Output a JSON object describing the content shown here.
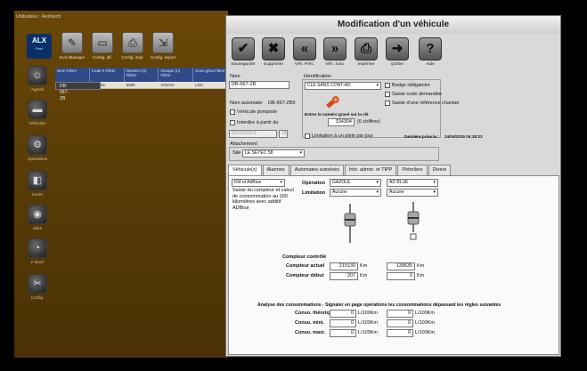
{
  "background_app": {
    "title": "Utilisateur : Autotech",
    "logo": {
      "text": "ALX",
      "sub": "Fleet"
    },
    "toolbar": [
      {
        "label": "Invit./Manager",
        "icon": "wrench-icon"
      },
      {
        "label": "Config. aff.",
        "icon": "monitor-icon"
      },
      {
        "label": "Config. impr.",
        "icon": "printer-icon"
      },
      {
        "label": "Config. export",
        "icon": "export-icon"
      }
    ],
    "sidebar": [
      {
        "label": "Agents",
        "icon": "person-icon"
      },
      {
        "label": "Véhicules",
        "icon": "truck-icon"
      },
      {
        "label": "Opérations",
        "icon": "gear-icon"
      },
      {
        "label": "Cuves",
        "icon": "tank-icon"
      },
      {
        "label": "Sites",
        "icon": "globe-icon"
      },
      {
        "label": "F-Bord",
        "icon": "chart-icon"
      },
      {
        "label": "Config.",
        "icon": "tools-icon"
      }
    ],
    "grid": {
      "headers": [
        "Nom Filtrer",
        "Code ▾ Filtrer",
        "Numéro (n) Filtrer",
        "Groupe (n) Filtrer",
        "Sous-grou Filtrer"
      ],
      "rows": [
        [
          "DB-667-ZB",
          "",
          "",
          "",
          ""
        ],
        [
          "DB-667-ZB",
          "334304",
          "5008",
          "VOLVO",
          "LOC"
        ]
      ]
    }
  },
  "window": {
    "title": "Modification d'un véhicule",
    "toolbar": [
      {
        "label": "Sauvegarder",
        "icon": "check-icon",
        "glyph": "✔"
      },
      {
        "label": "Supprimer",
        "icon": "delete-icon",
        "glyph": "✖"
      },
      {
        "label": "Véh. Préc.",
        "icon": "previous-icon",
        "glyph": "«"
      },
      {
        "label": "Véh. Suiv.",
        "icon": "next-icon",
        "glyph": "»"
      },
      {
        "label": "Imprimer",
        "icon": "printer-icon",
        "glyph": "⎙"
      },
      {
        "label": "Quitter",
        "icon": "exit-icon",
        "glyph": "➜"
      },
      {
        "label": "Aide",
        "icon": "help-icon",
        "glyph": "?"
      }
    ],
    "nom_label": "Nom",
    "nom_value": "DB-667-ZB",
    "nom_auto_label": "Nom automate:",
    "nom_auto_value": "DB-667-ZB6",
    "vehicule_pompiste_label": "Véhicule pompiste",
    "interdire_label": "Interdire à partir du",
    "interdire_date": "09/12/2013",
    "identification": {
      "title": "Identification",
      "key_type": "CLE SANS CONT-AD",
      "badge_label": "Badge obligatoire",
      "saisie_code_label": "Saisie code demandée",
      "saisie_ref_label": "Saisie d'une référence chantier",
      "key_hint": "Entrer le numéro gravé sur la clé",
      "key_number": "334304",
      "key_suffix": "(6 chiffres)",
      "limitation_label": "Limitation à un plein par jour",
      "derniere_prise_label": "Dernière prise le :",
      "derniere_prise_value": "24/04/2015 04:38:23"
    },
    "attachement": {
      "title": "Attachement",
      "site_label": "Site",
      "site_value": "LE SEYEC 58"
    },
    "tabs": [
      "Véhicule(s)",
      "Alarmes",
      "Automates autorisés",
      "Info. admin. et TIPP",
      "Pétroliers",
      "Divers"
    ],
    "vehicules_tab": {
      "compteur_type": "KM et AdBlue",
      "compteur_desc": "Saisie du compteur et calcul de consommation au 100 kilomètres avec additif ADBlue",
      "operation_label": "Opération",
      "limitation_label": "Limitation",
      "operation_1": "GAZOLE",
      "operation_2": "AD BLUE",
      "limitation_1": "Aucune",
      "limitation_2": "Aucune",
      "compteur_controle_label": "Compteur contrôlé",
      "compteur_actuel_label": "Compteur actuel",
      "compteur_debut_label": "Compteur début",
      "actuel_1": "210130",
      "actuel_2": "139635",
      "debut_1": "207",
      "debut_2": "0",
      "unit_km": "Km",
      "analyse_title": "Analyse des consommations - Signaler en page opérations les consommations dépassant les règles suivantes",
      "conso_rows": [
        {
          "label": "Conso. théorique",
          "v1": "0",
          "u1": "L/100Km",
          "v2": "0",
          "u2": "L/100Km"
        },
        {
          "label": "Conso. mini.",
          "v1": "0",
          "u1": "L/100Km",
          "v2": "0",
          "u2": "L/100Km"
        },
        {
          "label": "Conso. maxi.",
          "v1": "0",
          "u1": "L/100Km",
          "v2": "0",
          "u2": "L/100Km"
        }
      ]
    }
  }
}
